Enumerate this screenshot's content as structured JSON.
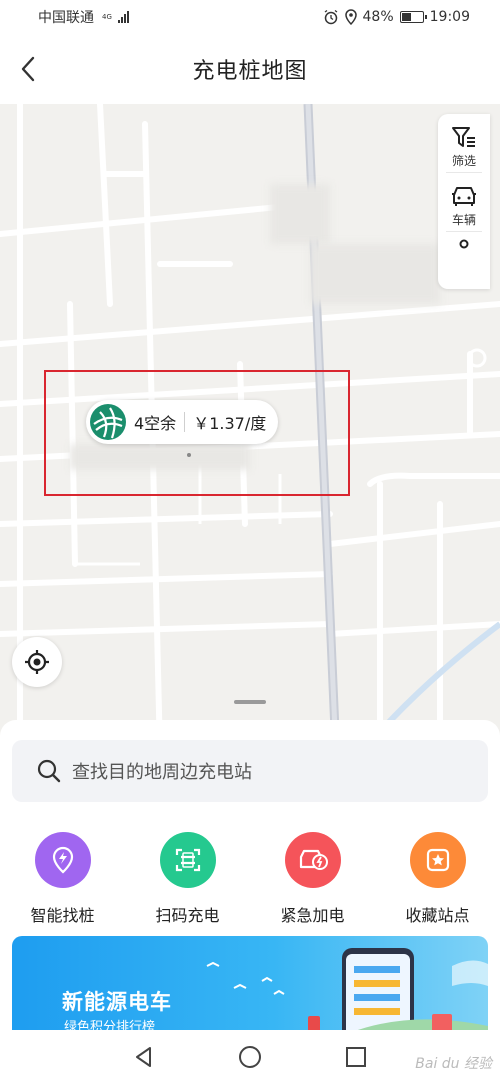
{
  "status_bar": {
    "carrier": "中国联通",
    "network": "4G",
    "battery": "48%",
    "battery_level": 0.48,
    "time": "19:09"
  },
  "header": {
    "title": "充电桩地图"
  },
  "map": {
    "controls": [
      {
        "label": "筛选",
        "icon": "filter-icon"
      },
      {
        "label": "车辆",
        "icon": "car-icon"
      }
    ],
    "station": {
      "free_count": "4空余",
      "price": "￥1.37/度"
    }
  },
  "sheet": {
    "search_placeholder": "查找目的地周边充电站",
    "quick_actions": [
      {
        "label": "智能找桩",
        "icon": "smart-find-icon",
        "color": "#a066f0"
      },
      {
        "label": "扫码充电",
        "icon": "scan-icon",
        "color": "#25c98f"
      },
      {
        "label": "紧急加电",
        "icon": "emergency-charge-icon",
        "color": "#f5545a"
      },
      {
        "label": "收藏站点",
        "icon": "favorite-star-icon",
        "color": "#fd8a38"
      }
    ],
    "banner": {
      "title": "新能源电车",
      "subtitle": "绿色积分排行榜"
    }
  },
  "watermark": "Bai du 经验"
}
